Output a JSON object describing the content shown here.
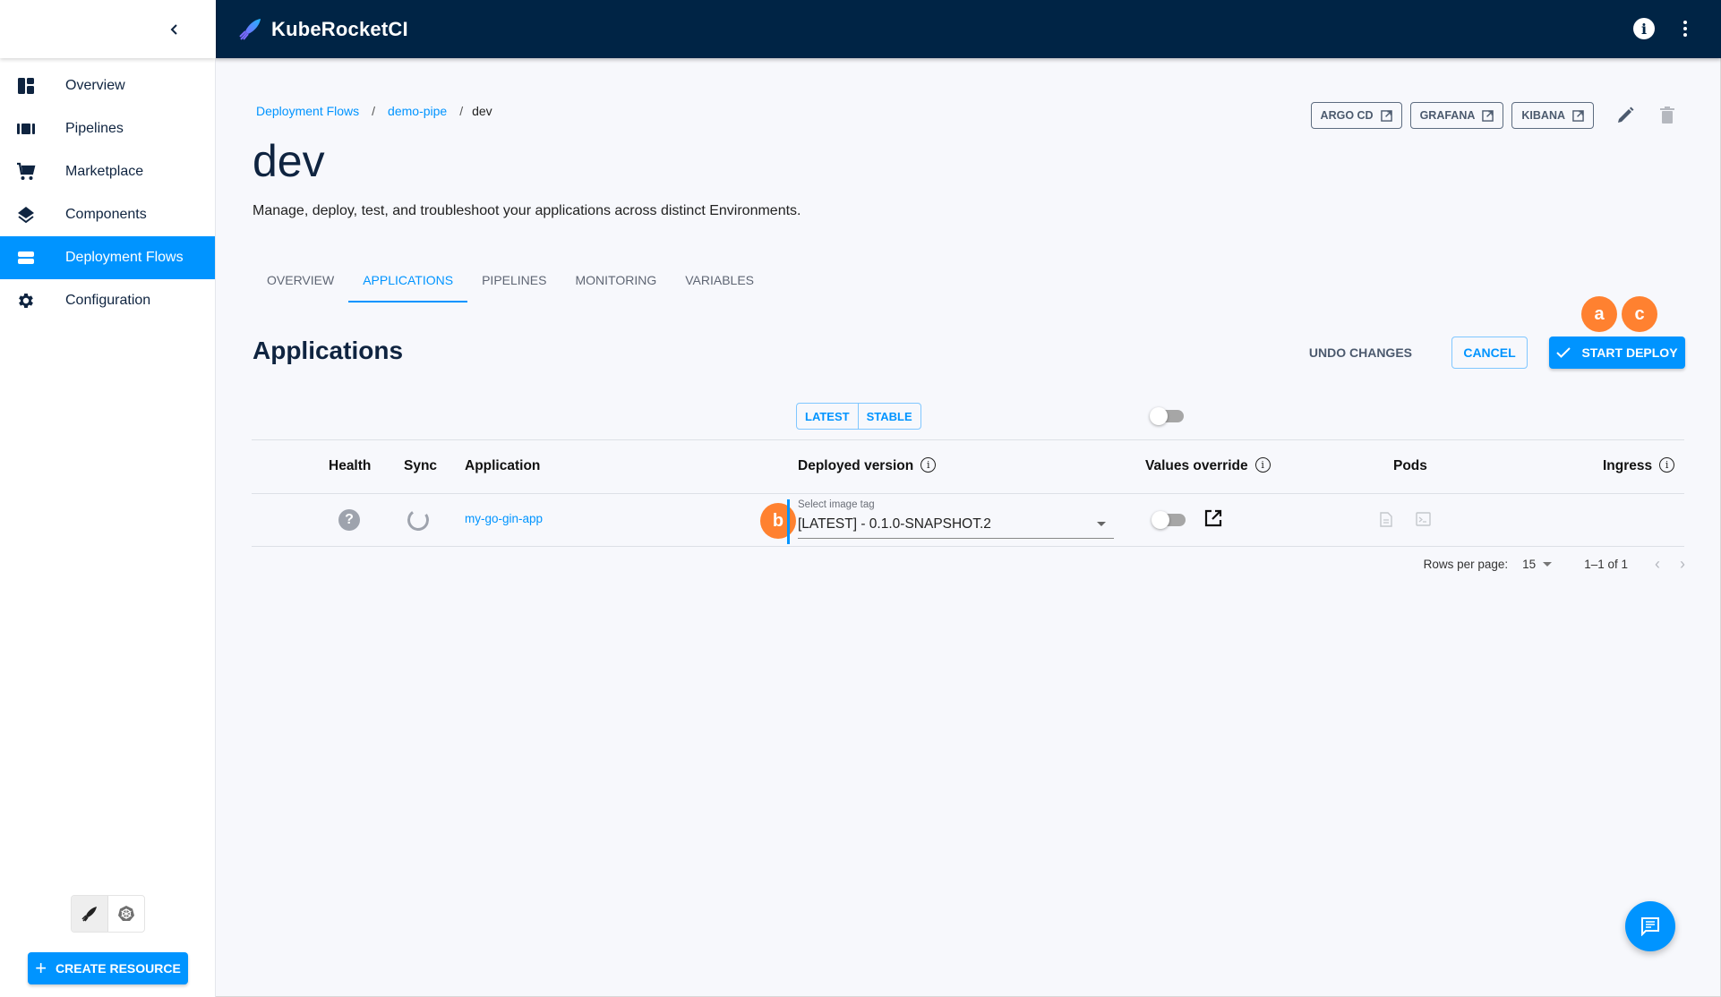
{
  "app": {
    "brand_name": "KubeRocketCI"
  },
  "sidebar": {
    "items": [
      {
        "label": "Overview",
        "icon": "dashboard-icon",
        "active": false
      },
      {
        "label": "Pipelines",
        "icon": "pipelines-icon",
        "active": false
      },
      {
        "label": "Marketplace",
        "icon": "cart-icon",
        "active": false
      },
      {
        "label": "Components",
        "icon": "layers-icon",
        "active": false
      },
      {
        "label": "Deployment Flows",
        "icon": "deployment-flows-icon",
        "active": true
      },
      {
        "label": "Configuration",
        "icon": "gear-icon",
        "active": false
      }
    ],
    "create_resource_label": "CREATE RESOURCE"
  },
  "breadcrumb": {
    "items": [
      {
        "label": "Deployment Flows",
        "link": true
      },
      {
        "label": "demo-pipe",
        "link": true
      },
      {
        "label": "dev",
        "link": false
      }
    ],
    "separator": "/"
  },
  "page": {
    "title": "dev",
    "description": "Manage, deploy, test, and troubleshoot your applications across distinct Environments."
  },
  "external_links": [
    {
      "label": "ARGO CD"
    },
    {
      "label": "GRAFANA"
    },
    {
      "label": "KIBANA"
    }
  ],
  "tabs": [
    {
      "label": "OVERVIEW",
      "active": false
    },
    {
      "label": "APPLICATIONS",
      "active": true
    },
    {
      "label": "PIPELINES",
      "active": false
    },
    {
      "label": "MONITORING",
      "active": false
    },
    {
      "label": "VARIABLES",
      "active": false
    }
  ],
  "applications": {
    "title": "Applications",
    "undo_label": "UNDO CHANGES",
    "cancel_label": "CANCEL",
    "start_deploy_label": "START DEPLOY",
    "version_options": [
      "LATEST",
      "STABLE"
    ],
    "global_values_override": false,
    "markers": [
      "a",
      "b",
      "c"
    ],
    "columns": {
      "health": "Health",
      "sync": "Sync",
      "application": "Application",
      "deployed_version": "Deployed version",
      "values_override": "Values override",
      "pods": "Pods",
      "ingress": "Ingress"
    },
    "rows": [
      {
        "health": "unknown",
        "sync": "progressing",
        "application": "my-go-gin-app",
        "image_tag_label": "Select image tag",
        "image_tag_value": "[LATEST] - 0.1.0-SNAPSHOT.2",
        "values_override": false
      }
    ],
    "pagination": {
      "rows_per_page_label": "Rows per page:",
      "rows_per_page": "15",
      "range": "1–1 of 1"
    }
  },
  "colors": {
    "primary": "#0094ff",
    "topbar": "#002445",
    "marker": "#ff8130"
  }
}
